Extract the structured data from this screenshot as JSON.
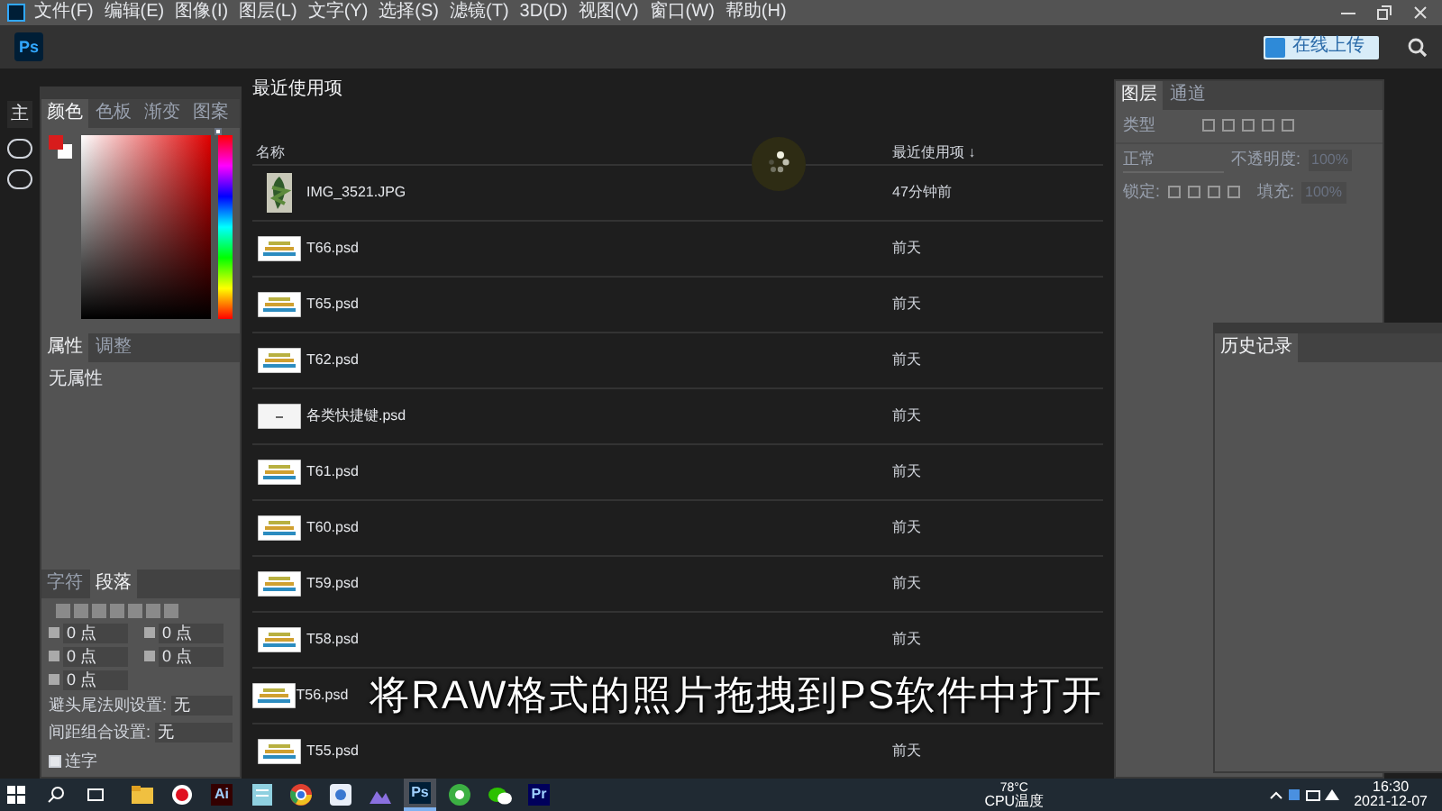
{
  "menu_bar": {
    "items": [
      "文件(F)",
      "编辑(E)",
      "图像(I)",
      "图层(L)",
      "文字(Y)",
      "选择(S)",
      "滤镜(T)",
      "3D(D)",
      "视图(V)",
      "窗口(W)",
      "帮助(H)"
    ]
  },
  "top_bar": {
    "logo": "Ps",
    "upload_button": "在线上传"
  },
  "home_strip": {
    "label": "主"
  },
  "color_panel": {
    "tabs": [
      {
        "label": "颜色",
        "selected": true
      },
      {
        "label": "色板",
        "selected": false
      },
      {
        "label": "渐变",
        "selected": false
      },
      {
        "label": "图案",
        "selected": false
      }
    ],
    "hue_slider": {
      "level": 1
    }
  },
  "properties_panel": {
    "tabs": [
      {
        "label": "属性",
        "selected": true
      },
      {
        "label": "调整",
        "selected": false
      }
    ],
    "text": "无属性"
  },
  "paragraph_panel": {
    "tabs": [
      {
        "label": "字符",
        "selected": false
      },
      {
        "label": "段落",
        "selected": true
      }
    ],
    "fields": [
      {
        "value": "0 点"
      },
      {
        "value": "0 点"
      },
      {
        "value": "0 点"
      },
      {
        "value": "0 点"
      },
      {
        "value": "0 点"
      }
    ],
    "settings": [
      {
        "label": "避头尾法则设置:",
        "value": "无"
      },
      {
        "label": "间距组合设置:",
        "value": "无"
      }
    ],
    "hyphenate": {
      "label": "连字",
      "checked": true
    }
  },
  "recent": {
    "title": "最近使用项",
    "columns": [
      "名称",
      "最近使用项 ↓"
    ],
    "rows": [
      {
        "name": "IMG_3521.JPG",
        "time": "47分钟前"
      },
      {
        "name": "T66.psd",
        "time": "前天",
        "kind": "design"
      },
      {
        "name": "T65.psd",
        "time": "前天",
        "kind": "design"
      },
      {
        "name": "T62.psd",
        "time": "前天",
        "kind": "design"
      },
      {
        "name": "各类快捷键.psd",
        "time": "前天",
        "kind": "blank"
      },
      {
        "name": "T61.psd",
        "time": "前天",
        "kind": "design"
      },
      {
        "name": "T60.psd",
        "time": "前天",
        "kind": "design"
      },
      {
        "name": "T59.psd",
        "time": "前天",
        "kind": "design"
      },
      {
        "name": "T58.psd",
        "time": "前天",
        "kind": "design"
      },
      {
        "name": "T56.psd",
        "kind": "design"
      },
      {
        "name": "T55.psd",
        "time": "前天",
        "kind": "design"
      }
    ]
  },
  "layers_panel": {
    "tabs": [
      {
        "label": "图层",
        "selected": true
      },
      {
        "label": "通道",
        "selected": false
      }
    ],
    "search_placeholder": "类型",
    "blend_mode": "正常",
    "opacity_label": "不透明度:",
    "opacity": "100%",
    "lock_label": "锁定:",
    "fill_label": "填充:",
    "fill": "100%"
  },
  "history_panel": {
    "tabs": [
      {
        "label": "历史记录",
        "selected": true
      }
    ]
  },
  "subtitle": "将RAW格式的照片拖拽到PS软件中打开",
  "taskbar": {
    "apps": [
      {
        "kind": "folder",
        "selected": false
      },
      {
        "kind": "record",
        "selected": false
      },
      {
        "kind": "badge",
        "label": "Ai",
        "color": "#330000",
        "selected": false
      },
      {
        "kind": "notepad",
        "selected": false
      },
      {
        "kind": "chrome",
        "selected": false
      },
      {
        "kind": "tool",
        "selected": false
      },
      {
        "kind": "mountain",
        "selected": false
      },
      {
        "kind": "badge",
        "label": "Ps",
        "color": "#001e36",
        "selected": true
      },
      {
        "kind": "green",
        "selected": false
      },
      {
        "kind": "chat",
        "selected": false
      },
      {
        "kind": "badge",
        "label": "Pr",
        "color": "#00005b",
        "selected": false
      }
    ],
    "temperature": "78°C",
    "temperature_label": "CPU温度",
    "time": "16:30",
    "date": "2021-12-07"
  }
}
